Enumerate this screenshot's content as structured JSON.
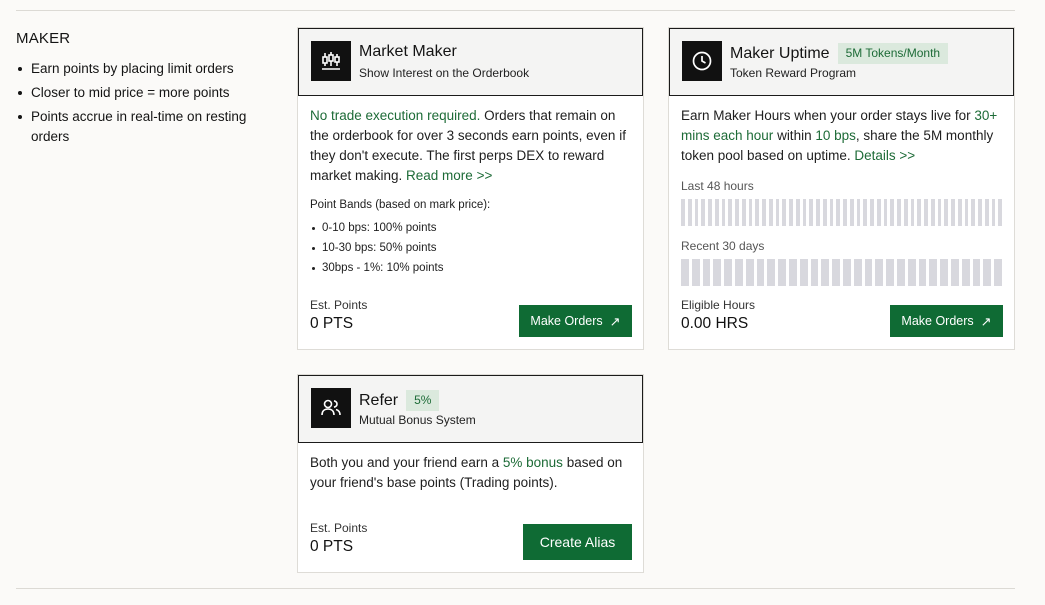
{
  "maker": {
    "title": "MAKER",
    "bullets": [
      "Earn points by placing limit orders",
      "Closer to mid price = more points",
      "Points accrue in real-time on resting orders"
    ]
  },
  "market_maker": {
    "title": "Market Maker",
    "subtitle": "Show Interest on the Orderbook",
    "icon": "candlestick-chart-icon",
    "desc_highlight": "No trade execution required.",
    "desc_text": " Orders that remain on the orderbook for over 3 seconds earn points, even if they don't execute. The first perps DEX to reward market making. ",
    "read_more": "Read more >>",
    "bands_title": "Point Bands (based on mark price):",
    "bands": [
      "0-10 bps: 100% points",
      "10-30 bps: 50% points",
      "30bps - 1%: 10% points"
    ],
    "est_label": "Est. Points",
    "est_value": "0 PTS",
    "button": "Make Orders",
    "button_arrow": "↗"
  },
  "maker_uptime": {
    "title": "Maker Uptime",
    "pill": "5M Tokens/Month",
    "subtitle": "Token Reward Program",
    "icon": "clock-icon",
    "desc_1": "Earn Maker Hours when your order stays live for ",
    "desc_h1": "30+ mins each hour",
    "desc_2": " within ",
    "desc_h2": "10 bps",
    "desc_3": ", share the 5M monthly token pool based on uptime. ",
    "details": "Details >>",
    "last48_label": "Last 48 hours",
    "last30_label": "Recent 30 days",
    "est_label": "Eligible Hours",
    "est_value": "0.00 HRS",
    "button": "Make Orders",
    "button_arrow": "↗"
  },
  "refer": {
    "title": "Refer",
    "pill": "5%",
    "subtitle": "Mutual Bonus System",
    "icon": "users-icon",
    "desc_1": "Both you and your friend earn a ",
    "desc_h": "5% bonus",
    "desc_2": " based on your friend's base points (Trading points).",
    "est_label": "Est. Points",
    "est_value": "0 PTS",
    "button": "Create Alias"
  },
  "colors": {
    "accent": "#0f6b34",
    "accent_text": "#1d6b37",
    "pill_bg": "#dbe9dd",
    "bar": "#d8d8de"
  }
}
